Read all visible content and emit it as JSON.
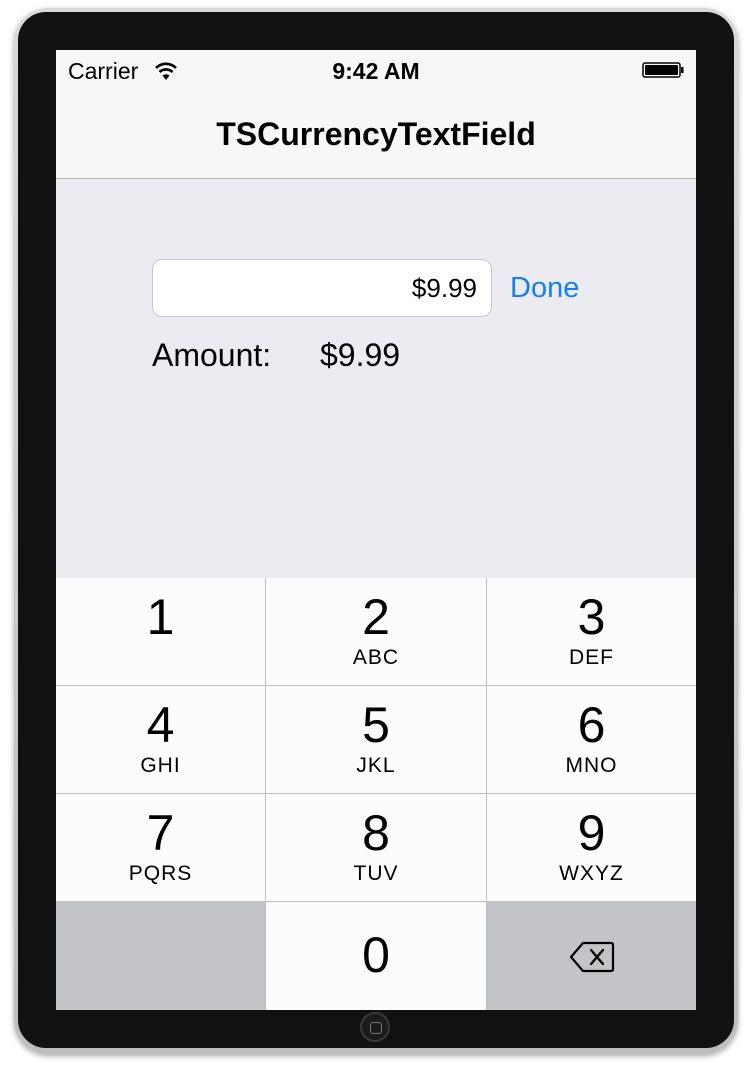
{
  "status_bar": {
    "carrier": "Carrier",
    "time": "9:42 AM",
    "wifi_icon": "wifi-icon",
    "battery_icon": "battery-icon"
  },
  "nav": {
    "title": "TSCurrencyTextField"
  },
  "form": {
    "field_value": "$9.99",
    "done_label": "Done",
    "amount_label": "Amount:",
    "amount_value": "$9.99"
  },
  "keypad": {
    "keys": [
      {
        "num": "1",
        "letters": ""
      },
      {
        "num": "2",
        "letters": "ABC"
      },
      {
        "num": "3",
        "letters": "DEF"
      },
      {
        "num": "4",
        "letters": "GHI"
      },
      {
        "num": "5",
        "letters": "JKL"
      },
      {
        "num": "6",
        "letters": "MNO"
      },
      {
        "num": "7",
        "letters": "PQRS"
      },
      {
        "num": "8",
        "letters": "TUV"
      },
      {
        "num": "9",
        "letters": "WXYZ"
      },
      {
        "num": "0",
        "letters": ""
      }
    ],
    "delete_icon": "delete-backspace-icon"
  },
  "colors": {
    "accent": "#157efb",
    "screen_bg": "#ebebf1",
    "bar_bg": "#f7f7f7",
    "key_bg": "#fcfcfc",
    "key_dark": "#c3c4c8"
  }
}
